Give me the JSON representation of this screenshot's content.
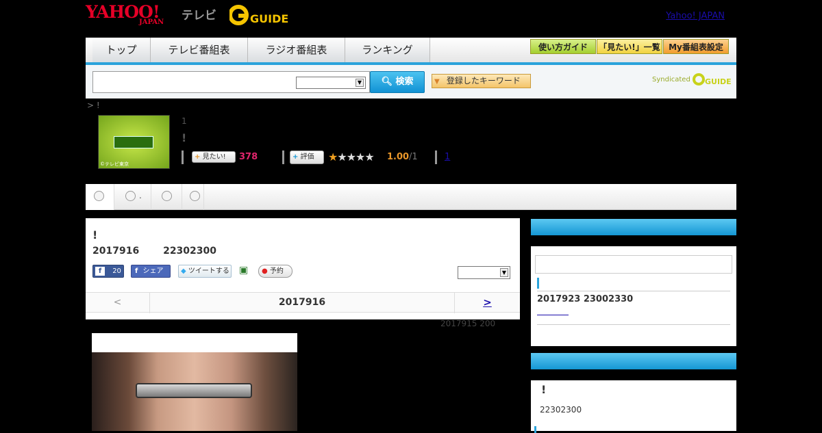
{
  "header": {
    "logo_yahoo": "YAHOO!",
    "logo_japan": "JAPAN",
    "logo_tv": "テレビ",
    "logo_gguide": "GUIDE",
    "yahoo_japan_link": "Yahoo! JAPAN"
  },
  "nav": {
    "tabs": [
      "トップ",
      "テレビ番組表",
      "ラジオ番組表",
      "ランキング"
    ],
    "sub_buttons": [
      "使い方ガイド",
      "「見たい!」一覧",
      "My番組表設定"
    ]
  },
  "search": {
    "button_label": "検索",
    "keyword_button": "登録したキーワード",
    "syndicated": "Syndicated"
  },
  "breadcrumb": "> !",
  "program": {
    "thumb_caption": "©テレビ東京",
    "number": "1",
    "title": "!",
    "want_label": "見たい!",
    "want_count": "378",
    "rate_label": "評価",
    "rating": "1.00",
    "rating_count": "/1",
    "review_link": "1",
    "stars_filled": 1
  },
  "tabs": {
    "items": [
      "",
      ".",
      "",
      ""
    ]
  },
  "episode": {
    "title": "!",
    "date": "2017916",
    "time": "22302300",
    "fb_count": "20",
    "share_label": "シェア",
    "tweet_label": "ツイートする",
    "reserve_label": "予約",
    "nav_prev": "<",
    "nav_current": "2017916",
    "nav_next": ">",
    "prev_air": "2017915  200"
  },
  "sidebar": {
    "box1_date": "2017923  23002330",
    "box2_title": "!",
    "box2_time": "22302300"
  },
  "colors": {
    "accent_blue": "#2aa3db",
    "want_pink": "#e0256c",
    "rating_orange": "#e8962a"
  }
}
